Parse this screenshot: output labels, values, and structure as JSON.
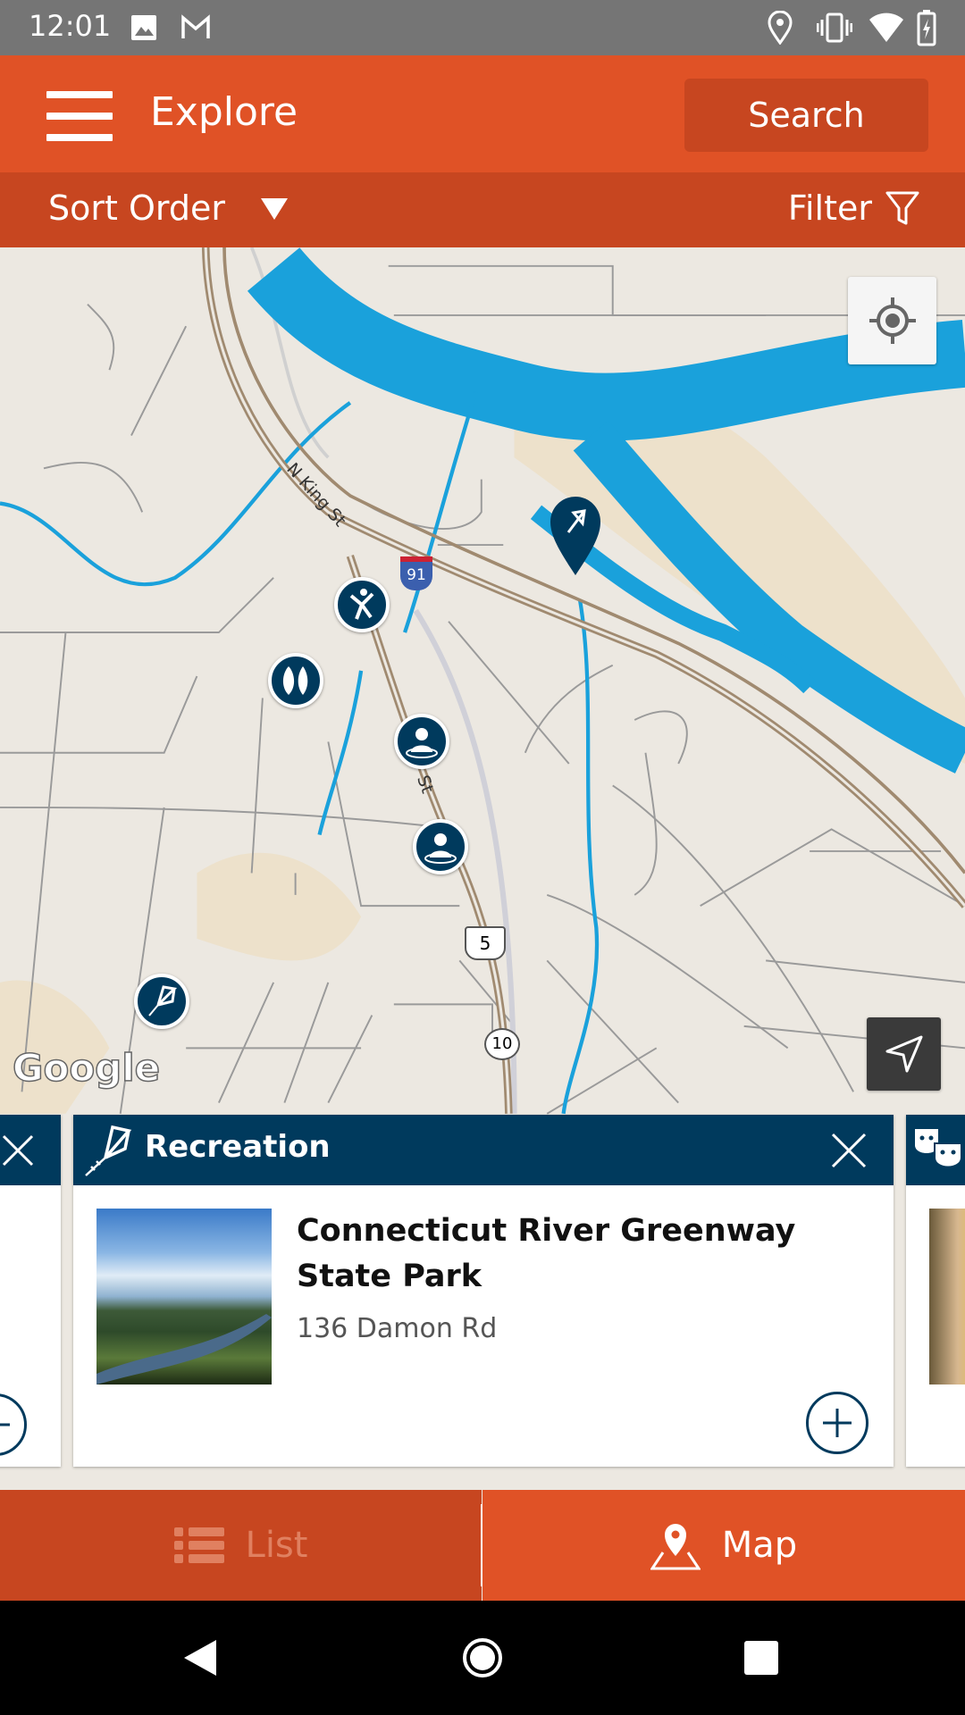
{
  "status_bar": {
    "time": "12:01",
    "icons": [
      "image-icon",
      "gmail-icon",
      "location-icon",
      "vibrate-icon",
      "wifi-icon",
      "battery-charging-icon"
    ]
  },
  "header": {
    "title": "Explore",
    "search_label": "Search",
    "menu_icon": "hamburger-icon"
  },
  "sort_bar": {
    "sort_label": "Sort Order",
    "filter_label": "Filter"
  },
  "map": {
    "labels": {
      "street_n_king": "N King St",
      "street_king": "St",
      "route_91": "91",
      "route_5": "5",
      "route_10": "10"
    },
    "attribution": "Google",
    "colors": {
      "water": "#1aa1db",
      "land": "#ece8e1",
      "park": "#ede1cb",
      "marker": "#003a5d"
    },
    "markers": [
      "recreation-pin-selected",
      "dance-marker",
      "nature-marker",
      "person-marker",
      "person-marker",
      "recreation-marker"
    ]
  },
  "cards": {
    "current": {
      "category": "Recreation",
      "name": "Connecticut River Greenway State Park",
      "address": "136 Damon Rd",
      "category_icon": "kite-icon"
    },
    "next_category_icon": "theater-masks-icon"
  },
  "bottom_nav": {
    "list_label": "List",
    "map_label": "Map",
    "active": "Map"
  },
  "colors": {
    "brand": "#e05226",
    "brand_dark": "#c74620",
    "card_header": "#003a5d"
  }
}
